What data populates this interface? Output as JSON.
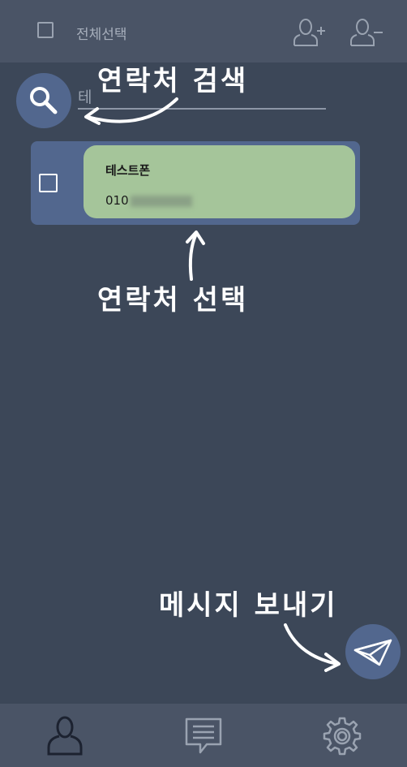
{
  "header": {
    "select_all_label": "전체선택",
    "icons": [
      "add-user-icon",
      "remove-user-icon"
    ]
  },
  "search": {
    "icon": "search-icon",
    "value": "테"
  },
  "contacts": [
    {
      "name": "테스트폰",
      "phone_visible": "010",
      "phone_redacted": true,
      "checked": false
    }
  ],
  "annotations": {
    "search": "연락처 검색",
    "select": "연락처 선택",
    "send": "메시지 보내기"
  },
  "send_button": {
    "icon": "paper-plane-icon"
  },
  "bottom_nav": {
    "items": [
      "contacts-icon",
      "messages-icon",
      "settings-icon"
    ],
    "active": "contacts-icon"
  },
  "colors": {
    "background": "#3c4758",
    "bar": "#4a5466",
    "accent": "#52678e",
    "card": "#a5c59a"
  }
}
